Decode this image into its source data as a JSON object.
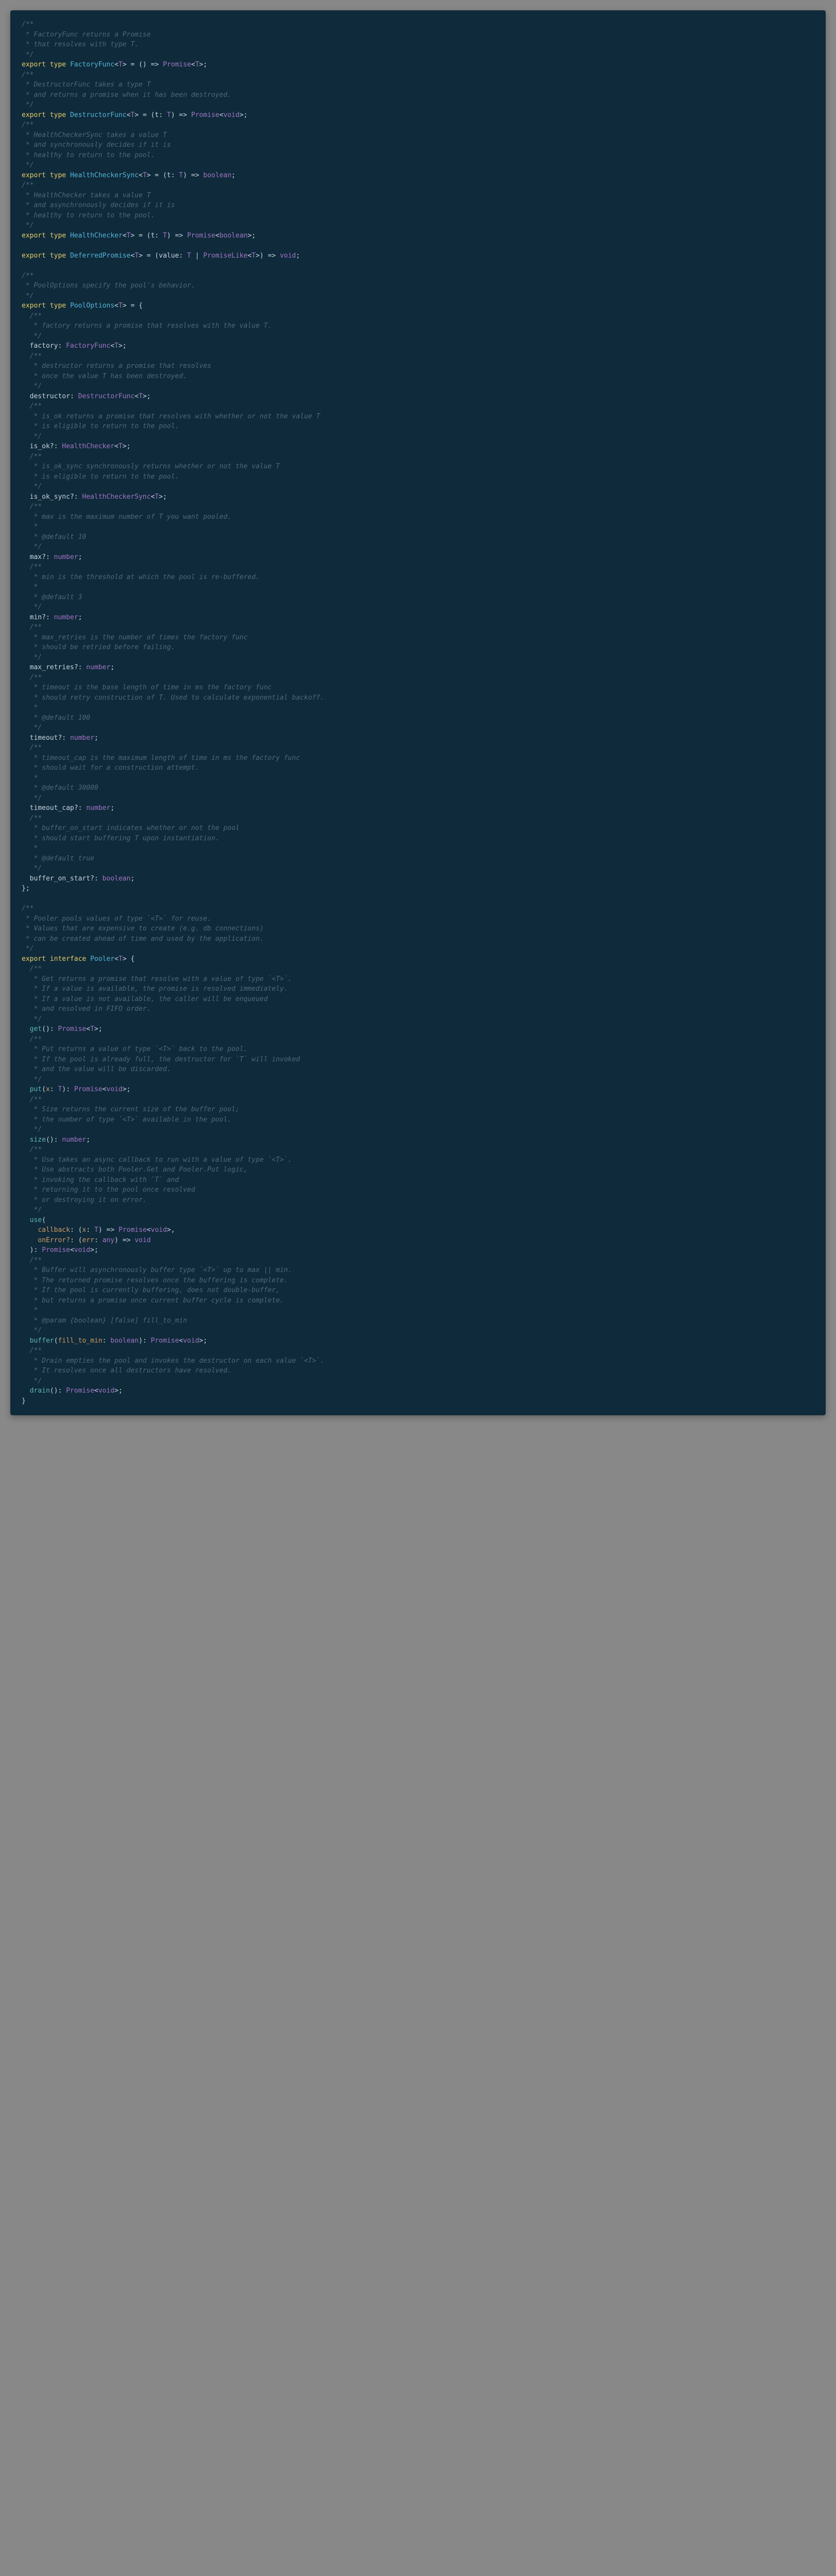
{
  "factoryFunc": {
    "doc1": " * FactoryFunc returns a Promise",
    "doc2": " * that resolves with type T.",
    "kw_export": "export",
    "kw_type": "type",
    "name": "FactoryFunc",
    "sig_open": "<",
    "T": "T",
    "sig_close": ">",
    "eq": " = ",
    "paren": "() => ",
    "ret": "Promise",
    "ret_open": "<",
    "ret_T": "T",
    "ret_close": ">;"
  },
  "destructorFunc": {
    "doc1": " * DestructorFunc takes a type T",
    "doc2": " * and returns a promise when it has been destroyed.",
    "kw_export": "export",
    "kw_type": "type",
    "name": "DestructorFunc",
    "T": "T",
    "sig": " = (t: ",
    "T2": "T",
    "arrow": ") => ",
    "ret": "Promise",
    "void": "void",
    "close": ">;"
  },
  "healthCheckerSync": {
    "doc1": " * HealthCheckerSync takes a value T",
    "doc2": " * and synchronously decides if it is",
    "doc3": " * healthy to return to the pool.",
    "kw_export": "export",
    "kw_type": "type",
    "name": "HealthCheckerSync",
    "T": "T",
    "sig": " = (t: ",
    "T2": "T",
    "arrow": ") => ",
    "ret": "boolean",
    "close": ";"
  },
  "healthChecker": {
    "doc1": " * HealthChecker takes a value T",
    "doc2": " * and asynchronously decides if it is",
    "doc3": " * healthy to return to the pool.",
    "kw_export": "export",
    "kw_type": "type",
    "name": "HealthChecker",
    "T": "T",
    "sig": " = (t: ",
    "T2": "T",
    "arrow": ") => ",
    "ret": "Promise",
    "bool": "boolean",
    "close": ">;"
  },
  "deferredPromise": {
    "kw_export": "export",
    "kw_type": "type",
    "name": "DeferredPromise",
    "T": "T",
    "sig": " = (value: ",
    "T2": "T",
    "pipe": " | ",
    "pl": "PromiseLike",
    "T3": "T",
    "arrow": ">) => ",
    "void": "void",
    "close": ";"
  },
  "poolOptions": {
    "doc1": " * PoolOptions specify the pool's behavior.",
    "kw_export": "export",
    "kw_type": "type",
    "name": "PoolOptions",
    "T": "T",
    "eq": " = {",
    "factory": {
      "doc1": "   * factory returns a promise that resolves with the value T.",
      "prop": "factory",
      "type": "FactoryFunc",
      "T": "T"
    },
    "destructor": {
      "doc1": "   * destructor returns a promise that resolves",
      "doc2": "   * once the value T has been destroyed.",
      "prop": "destructor",
      "type": "DestructorFunc",
      "T": "T"
    },
    "is_ok": {
      "doc1": "   * is_ok returns a promise that resolves with whether or not the value T",
      "doc2": "   * is eligible to return to the pool.",
      "prop": "is_ok?",
      "type": "HealthChecker",
      "T": "T"
    },
    "is_ok_sync": {
      "doc1": "   * is_ok_sync synchronously returns whether or not the value T",
      "doc2": "   * is eligible to return to the pool.",
      "prop": "is_ok_sync?",
      "type": "HealthCheckerSync",
      "T": "T"
    },
    "max": {
      "doc1": "   * max is the maximum number of T you want pooled.",
      "doc2": "   * @default 10",
      "prop": "max?",
      "type": "number"
    },
    "min": {
      "doc1": "   * min is the threshold at which the pool is re-buffered.",
      "doc2": "   * @default 3",
      "prop": "min?",
      "type": "number"
    },
    "max_retries": {
      "doc1": "   * max_retries is the number of times the factory func",
      "doc2": "   * should be retried before failing.",
      "prop": "max_retries?",
      "type": "number"
    },
    "timeout": {
      "doc1": "   * timeout is the base length of time in ms the factory func",
      "doc2": "   * should retry construction of T. Used to calculate exponential backoff.",
      "doc3": "   * @default 100",
      "prop": "timeout?",
      "type": "number"
    },
    "timeout_cap": {
      "doc1": "   * timeout_cap is the maximum length of time in ms the factory func",
      "doc2": "   * should wait for a construction attempt.",
      "doc3": "   * @default 30000",
      "prop": "timeout_cap?",
      "type": "number"
    },
    "buffer_on_start": {
      "doc1": "   * buffer_on_start indicates whether or not the pool",
      "doc2": "   * should start buffering T upon instantiation.",
      "doc3": "   * @default true",
      "prop": "buffer_on_start?",
      "type": "boolean"
    }
  },
  "pooler": {
    "doc1": " * Pooler pools values of type `<T>` for reuse.",
    "doc2": " * Values that are expensive to create (e.g. db connections)",
    "doc3": " * can be created ahead of time and used by the application.",
    "kw_export": "export",
    "kw_interface": "interface",
    "name": "Pooler",
    "T": "T",
    "open": " {",
    "get": {
      "doc1": "   * Get returns a promise that resolve with a value of type `<T>`.",
      "doc2": "   * If a value is available, the promise is resolved immediately.",
      "doc3": "   * If a value is not available, the caller will be enqueued",
      "doc4": "   * and resolved in FIFO order.",
      "prop": "get",
      "ret": "Promise",
      "T": "T"
    },
    "put": {
      "doc1": "   * Put returns a value of type `<T>` back to the pool.",
      "doc2": "   * If the pool is already full, the destructor for `T` will invoked",
      "doc3": "   * and the value will be discarded.",
      "prop": "put",
      "param": "x",
      "T": "T",
      "ret": "Promise",
      "void": "void"
    },
    "size": {
      "doc1": "   * Size returns the current size of the buffer pool;",
      "doc2": "   * the number of type `<T>` available in the pool.",
      "prop": "size",
      "ret": "number"
    },
    "use": {
      "doc1": "   * Use takes an async callback to run with a value of type `<T>`.",
      "doc2": "   * Use abstracts both Pooler.Get and Pooler.Put logic,",
      "doc3": "   * invoking the callback with `T` and",
      "doc4": "   * returning it to the pool once resolved",
      "doc5": "   * or destroying it on error.",
      "prop": "use",
      "cb": "callback",
      "cb_param": "x",
      "T": "T",
      "cb_ret": "Promise",
      "cb_void": "void",
      "onErr": "onError?",
      "err_param": "err",
      "any": "any",
      "err_ret": "void",
      "ret": "Promise",
      "void": "void"
    },
    "buffer": {
      "doc1": "   * Buffer will asynchronously buffer type `<T>` up to max || min.",
      "doc2": "   * The returned promise resolves once the buffering is complete.",
      "doc3": "   * If the pool is currently buffering, does not double-buffer,",
      "doc4": "   * but returns a promise once current buffer cycle is complete.",
      "doc5": "   * @param {boolean} [false] fill_to_min",
      "prop": "buffer",
      "param": "fill_to_min",
      "ptype": "boolean",
      "ret": "Promise",
      "void": "void"
    },
    "drain": {
      "doc1": "   * Drain empties the pool and invokes the destructor on each value `<T>`.",
      "doc2": "   * It resolves once all destructors have resolved.",
      "prop": "drain",
      "ret": "Promise",
      "void": "void"
    }
  },
  "comment_open": "/**",
  "comment_close": " */",
  "comment_blank": "   *",
  "comment_blank_outer": " *",
  "inner_open": "  /**",
  "inner_close": "   */",
  "close_brace": "};",
  "close_brace2": "}"
}
